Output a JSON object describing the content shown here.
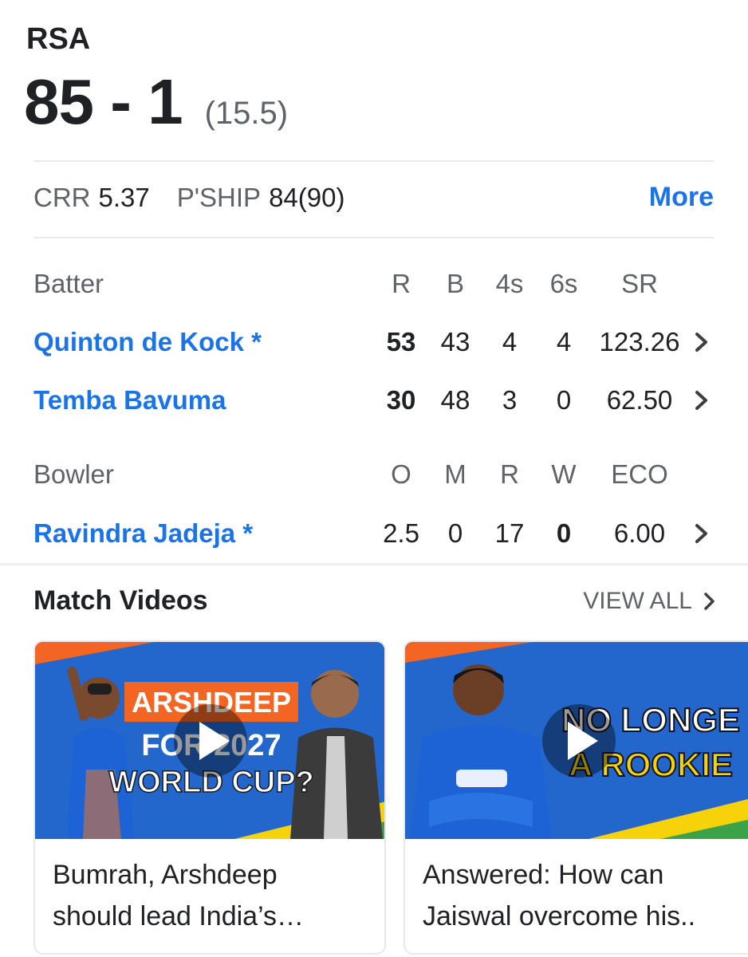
{
  "team": "RSA",
  "score": "85 - 1",
  "overs": "(15.5)",
  "stats": {
    "crr_label": "CRR",
    "crr_value": "5.37",
    "pship_label": "P'SHIP",
    "pship_value": "84(90)",
    "more": "More"
  },
  "batting": {
    "header": [
      "Batter",
      "R",
      "B",
      "4s",
      "6s",
      "SR"
    ],
    "rows": [
      {
        "name": "Quinton de Kock *",
        "r": "53",
        "b": "43",
        "fours": "4",
        "sixes": "4",
        "sr": "123.26"
      },
      {
        "name": "Temba Bavuma",
        "r": "30",
        "b": "48",
        "fours": "3",
        "sixes": "0",
        "sr": "62.50"
      }
    ]
  },
  "bowling": {
    "header": [
      "Bowler",
      "O",
      "M",
      "R",
      "W",
      "ECO"
    ],
    "rows": [
      {
        "name": "Ravindra Jadeja *",
        "o": "2.5",
        "m": "0",
        "r": "17",
        "w": "0",
        "eco": "6.00"
      }
    ]
  },
  "videos": {
    "title": "Match Videos",
    "view_all": "VIEW ALL",
    "items": [
      {
        "thumb_lines": [
          "ARSHDEEP",
          "FOR 2027",
          "WORLD CUP?"
        ],
        "caption_1": "Bumrah, Arshdeep",
        "caption_2": "should lead India’s…"
      },
      {
        "thumb_lines": [
          "NO LONGE",
          "A ROOKIE"
        ],
        "caption_1": "Answered: How can",
        "caption_2": "Jaiswal overcome his.."
      }
    ]
  },
  "colors": {
    "link": "#1a73e8",
    "muted": "#5f6368",
    "text": "#202124",
    "thumb_blue": "#1f5fc2",
    "thumb_orange": "#f26522",
    "thumb_yellow": "#f5d20a"
  }
}
